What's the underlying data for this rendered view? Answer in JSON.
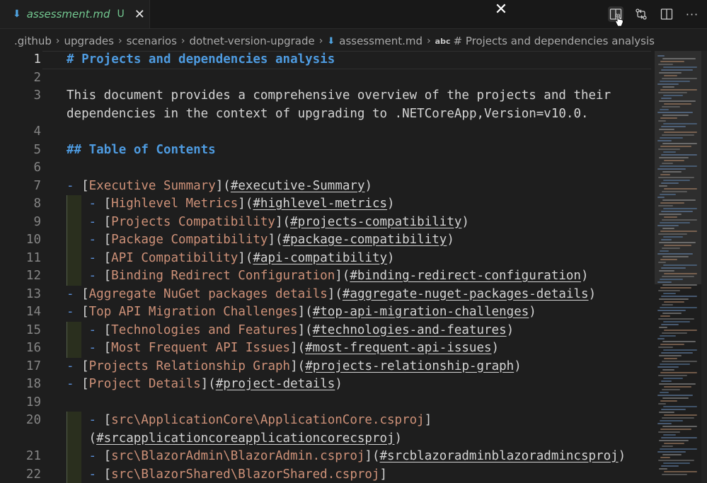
{
  "tab": {
    "filename": "assessment.md",
    "status": "U"
  },
  "toolbar": {
    "icons": [
      "open-preview-icon",
      "compare-changes-icon",
      "split-editor-icon",
      "more-actions-icon"
    ],
    "more_label": "···"
  },
  "breadcrumb": {
    "segments": [
      ".github",
      "upgrades",
      "scenarios",
      "dotnet-version-upgrade"
    ],
    "file": "assessment.md",
    "symbol_badge": "abc",
    "symbol": "# Projects and dependencies analysis"
  },
  "editor": {
    "lines": [
      {
        "n": "1",
        "text": "# Projects and dependencies analysis"
      },
      {
        "n": "2",
        "text": ""
      },
      {
        "n": "3",
        "text": "This document provides a comprehensive overview of the projects and their"
      },
      {
        "n": "",
        "text": "dependencies in the context of upgrading to .NETCoreApp,Version=v10.0."
      },
      {
        "n": "4",
        "text": ""
      },
      {
        "n": "5",
        "text": "## Table of Contents"
      },
      {
        "n": "6",
        "text": ""
      },
      {
        "n": "7",
        "link": "Executive Summary",
        "url": "#executive-Summary"
      },
      {
        "n": "8",
        "link": "Highlevel Metrics",
        "url": "#highlevel-metrics"
      },
      {
        "n": "9",
        "link": "Projects Compatibility",
        "url": "#projects-compatibility"
      },
      {
        "n": "10",
        "link": "Package Compatibility",
        "url": "#package-compatibility"
      },
      {
        "n": "11",
        "link": "API Compatibility",
        "url": "#api-compatibility"
      },
      {
        "n": "12",
        "link": "Binding Redirect Configuration",
        "url": "#binding-redirect-configuration"
      },
      {
        "n": "13",
        "link": "Aggregate NuGet packages details",
        "url": "#aggregate-nuget-packages-details"
      },
      {
        "n": "14",
        "link": "Top API Migration Challenges",
        "url": "#top-api-migration-challenges"
      },
      {
        "n": "15",
        "link": "Technologies and Features",
        "url": "#technologies-and-features"
      },
      {
        "n": "16",
        "link": "Most Frequent API Issues",
        "url": "#most-frequent-api-issues"
      },
      {
        "n": "17",
        "link": "Projects Relationship Graph",
        "url": "#projects-relationship-graph"
      },
      {
        "n": "18",
        "link": "Project Details",
        "url": "#project-details"
      },
      {
        "n": "19",
        "text": ""
      },
      {
        "n": "20",
        "link": "src\\ApplicationCore\\ApplicationCore.csproj"
      },
      {
        "n": "",
        "url": "#srcapplicationcoreapplicationcorecsproj"
      },
      {
        "n": "21",
        "link": "src\\BlazorAdmin\\BlazorAdmin.csproj",
        "url": "#srcblazoradminblazoradmincsproj"
      },
      {
        "n": "22",
        "link": "src\\BlazorShared\\BlazorShared.csproj"
      }
    ]
  }
}
